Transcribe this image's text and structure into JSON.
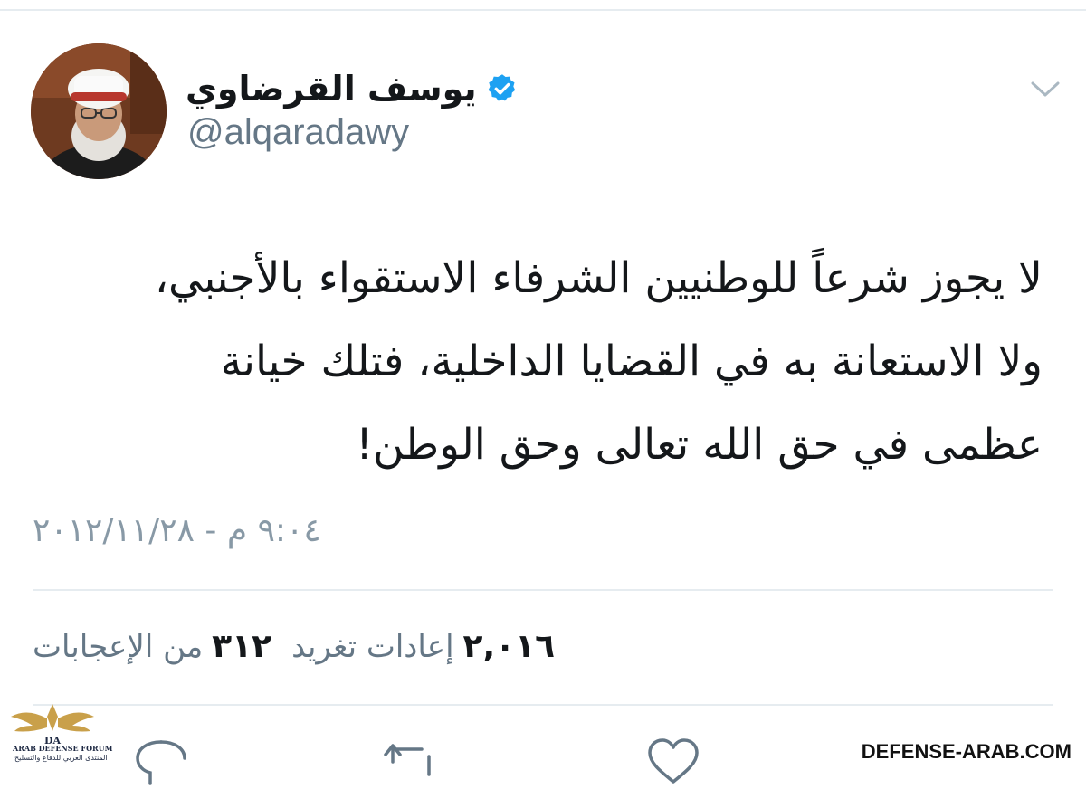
{
  "author": {
    "display_name": "يوسف القرضاوي",
    "handle": "@alqaradawy",
    "verified": true,
    "avatar_icon": "profile-photo"
  },
  "menu": {
    "icon": "chevron-down-icon"
  },
  "tweet": {
    "lines": [
      "لا يجوز شرعاً للوطنيين الشرفاء الاستقواء بالأجنبي،",
      "ولا الاستعانة به في القضايا الداخلية، فتلك خيانة",
      "عظمى في حق الله تعالى وحق الوطن!"
    ],
    "timestamp": "٩:٠٤ م - ٢٠١٢/١١/٢٨"
  },
  "stats": {
    "retweets_count": "٢,٠١٦",
    "retweets_label": "إعادات تغريد",
    "likes_count": "٣١٢",
    "likes_label": "من الإعجابات"
  },
  "actions": [
    {
      "name": "reply",
      "icon": "reply-icon"
    },
    {
      "name": "retweet",
      "icon": "retweet-icon"
    },
    {
      "name": "like",
      "icon": "heart-icon"
    }
  ],
  "watermark": {
    "site": "DEFENSE-ARAB.COM",
    "logo_text": "ARAB DEFENSE FORUM",
    "logo_sub": "المنتدى العربي للدفاع والتسليح",
    "logo_initials": "DA"
  },
  "colors": {
    "text": "#14171a",
    "secondary": "#657786",
    "timestamp": "#8899a6",
    "verified": "#1da1f2",
    "divider": "#e6ecf0"
  }
}
